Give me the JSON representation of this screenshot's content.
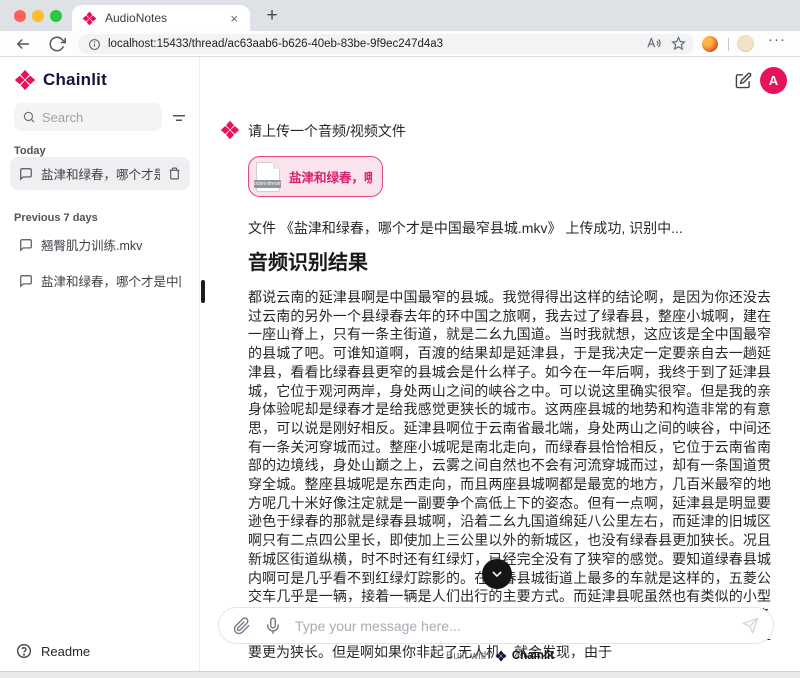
{
  "browser": {
    "tab_title": "AudioNotes",
    "close_glyph": "×",
    "new_tab_glyph": "+",
    "url": "localhost:15433/thread/ac63aab6-b626-40eb-83be-9f9ec247d4a3",
    "menu_glyph": "···"
  },
  "sidebar": {
    "brand": "Chainlit",
    "search_placeholder": "Search",
    "section_today": "Today",
    "section_previous": "Previous 7 days",
    "items": [
      {
        "title": "盐津和绿春，哪个才是中..."
      },
      {
        "title": "翘臀肌力训练.mkv"
      },
      {
        "title": "盐津和绿春，哪个才是中国..."
      }
    ],
    "readme": "Readme"
  },
  "header": {
    "avatar_letter": "A"
  },
  "chat": {
    "assistant_prompt": "请上传一个音频/视频文件",
    "attachment_name": "盐津和绿春，哪...",
    "attachment_mime": "octet-stream",
    "upload_status": "文件 《盐津和绿春，哪个才是中国最窄县城.mkv》 上传成功, 识别中...",
    "result_title": "音频识别结果",
    "transcript": "都说云南的延津县啊是中国最窄的县城。我觉得得出这样的结论啊，是因为你还没去过云南的另外一个县绿春去年的环中国之旅啊，我去过了绿春县，整座小城啊，建在一座山脊上，只有一条主街道，就是二幺九国道。当时我就想，这应该是全中国最窄的县城了吧。可谁知道啊，百渡的结果却是延津县，于是我决定一定要亲自去一趟延津县，看看比绿春县更窄的县城会是什么样子。如今在一年后啊，我终于到了延津县城，它位于观河两岸，身处两山之间的峡谷之中。可以说这里确实很窄。但是我的亲身体验呢却是绿春才是给我感觉更狭长的城市。这两座县城的地势和构造非常的有意思，可以说是刚好相反。延津县啊位于云南省最北端，身处两山之间的峡谷，中间还有一条关河穿城而过。整座小城呢是南北走向，而绿春县恰恰相反，它位于云南省南部的边境线，身处山巅之上，云雾之间自然也不会有河流穿城而过，却有一条国道贯穿全城。整座县城呢是东西走向，而且两座县城啊都是最宽的地方，几百米最窄的地方呢几十米好像注定就是一副要争个高低上下的姿态。但有一点啊，延津县是明显要逊色于绿春的那就是绿春县城啊，沿着二幺九国道绵延八公里左右，而延津的旧城区啊只有二点四公里长，即使加上三公里以外的新城区，也没有绿春县更加狭长。况且新城区街道纵横，时不时还有红绿灯，已经完全没有了狭窄的感觉。要知道绿春县城内啊可是几乎看不到红绿灯踪影的。在绿春县城街道上最多的车就是这样的，五菱公交车几乎是一辆，接着一辆是人们出行的主要方式。而延津县呢虽然也有类似的小型公交车，而数量上完全不是一个量级，似乎人们啊还是习惯于开车出门。城内有众多的单行道，显然是为了更方便人们开车，这也从另一个侧面反映出啊，绿春县显然是要更为狭长。但是啊如果你非起了无人机，就会发现，由于"
  },
  "composer": {
    "placeholder": "Type your message here..."
  },
  "footer": {
    "built_with": "Built with",
    "brand": "Chainlit"
  },
  "colors": {
    "accent": "#E8125C",
    "chip_border": "#E2477F",
    "chip_bg": "#FBE3ED",
    "fab": "#151515"
  }
}
